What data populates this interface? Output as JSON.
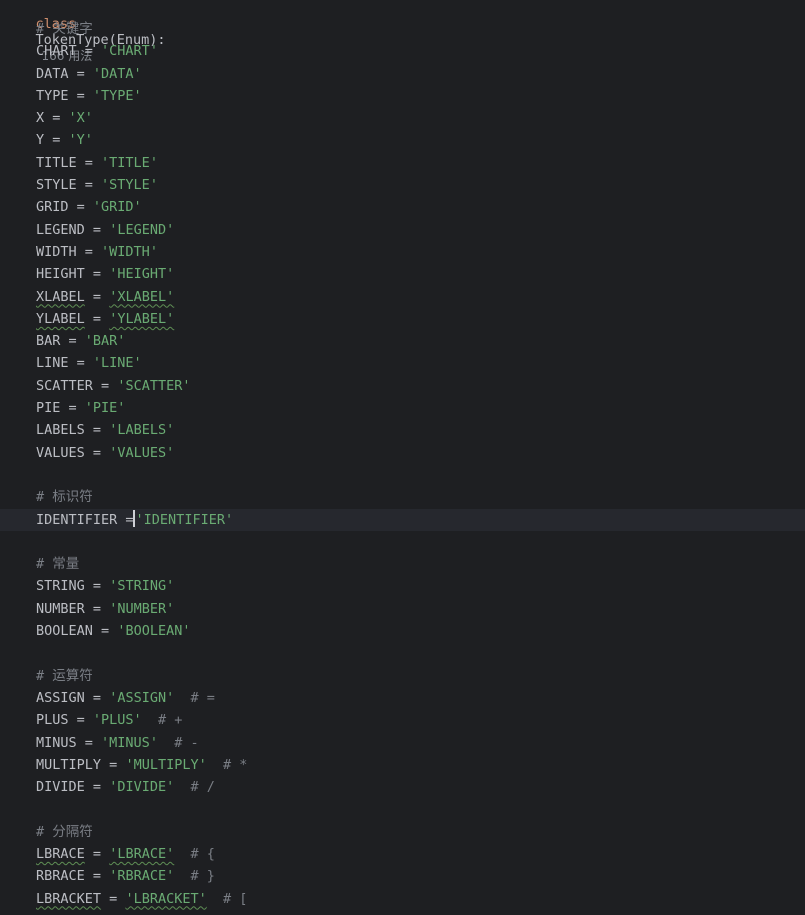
{
  "header": {
    "keyword": "class",
    "signature": "TokenType(Enum):",
    "usage_hint": "166 用法"
  },
  "colors": {
    "background": "#1e1f22",
    "keyword": "#cf8e6d",
    "string": "#6aab73",
    "comment": "#7a7e85",
    "text": "#bcbec4",
    "current_line": "#26282e"
  },
  "lines": [
    {
      "type": "comment",
      "text": "# 关键字"
    },
    {
      "type": "assign",
      "name": "CHART",
      "value": "'CHART'"
    },
    {
      "type": "assign",
      "name": "DATA",
      "value": "'DATA'"
    },
    {
      "type": "assign",
      "name": "TYPE",
      "value": "'TYPE'"
    },
    {
      "type": "assign",
      "name": "X",
      "value": "'X'"
    },
    {
      "type": "assign",
      "name": "Y",
      "value": "'Y'"
    },
    {
      "type": "assign",
      "name": "TITLE",
      "value": "'TITLE'"
    },
    {
      "type": "assign",
      "name": "STYLE",
      "value": "'STYLE'"
    },
    {
      "type": "assign",
      "name": "GRID",
      "value": "'GRID'"
    },
    {
      "type": "assign",
      "name": "LEGEND",
      "value": "'LEGEND'"
    },
    {
      "type": "assign",
      "name": "WIDTH",
      "value": "'WIDTH'"
    },
    {
      "type": "assign",
      "name": "HEIGHT",
      "value": "'HEIGHT'"
    },
    {
      "type": "assign",
      "name": "XLABEL",
      "value": "'XLABEL'",
      "warn": true
    },
    {
      "type": "assign",
      "name": "YLABEL",
      "value": "'YLABEL'",
      "warn": true
    },
    {
      "type": "assign",
      "name": "BAR",
      "value": "'BAR'"
    },
    {
      "type": "assign",
      "name": "LINE",
      "value": "'LINE'"
    },
    {
      "type": "assign",
      "name": "SCATTER",
      "value": "'SCATTER'"
    },
    {
      "type": "assign",
      "name": "PIE",
      "value": "'PIE'"
    },
    {
      "type": "assign",
      "name": "LABELS",
      "value": "'LABELS'"
    },
    {
      "type": "assign",
      "name": "VALUES",
      "value": "'VALUES'"
    },
    {
      "type": "blank"
    },
    {
      "type": "comment",
      "text": "# 标识符"
    },
    {
      "type": "assign",
      "name": "IDENTIFIER",
      "value": "'IDENTIFIER'",
      "current": true
    },
    {
      "type": "blank"
    },
    {
      "type": "comment",
      "text": "# 常量"
    },
    {
      "type": "assign",
      "name": "STRING",
      "value": "'STRING'"
    },
    {
      "type": "assign",
      "name": "NUMBER",
      "value": "'NUMBER'"
    },
    {
      "type": "assign",
      "name": "BOOLEAN",
      "value": "'BOOLEAN'"
    },
    {
      "type": "blank"
    },
    {
      "type": "comment",
      "text": "# 运算符"
    },
    {
      "type": "assign",
      "name": "ASSIGN",
      "value": "'ASSIGN'",
      "trailing": "# ="
    },
    {
      "type": "assign",
      "name": "PLUS",
      "value": "'PLUS'",
      "trailing": "# +"
    },
    {
      "type": "assign",
      "name": "MINUS",
      "value": "'MINUS'",
      "trailing": "# -"
    },
    {
      "type": "assign",
      "name": "MULTIPLY",
      "value": "'MULTIPLY'",
      "trailing": "# *"
    },
    {
      "type": "assign",
      "name": "DIVIDE",
      "value": "'DIVIDE'",
      "trailing": "# /"
    },
    {
      "type": "blank"
    },
    {
      "type": "comment",
      "text": "# 分隔符"
    },
    {
      "type": "assign",
      "name": "LBRACE",
      "value": "'LBRACE'",
      "trailing": "# {",
      "warn": true
    },
    {
      "type": "assign",
      "name": "RBRACE",
      "value": "'RBRACE'",
      "trailing": "# }"
    },
    {
      "type": "assign",
      "name": "LBRACKET",
      "value": "'LBRACKET'",
      "trailing": "# [",
      "warn": true
    }
  ]
}
